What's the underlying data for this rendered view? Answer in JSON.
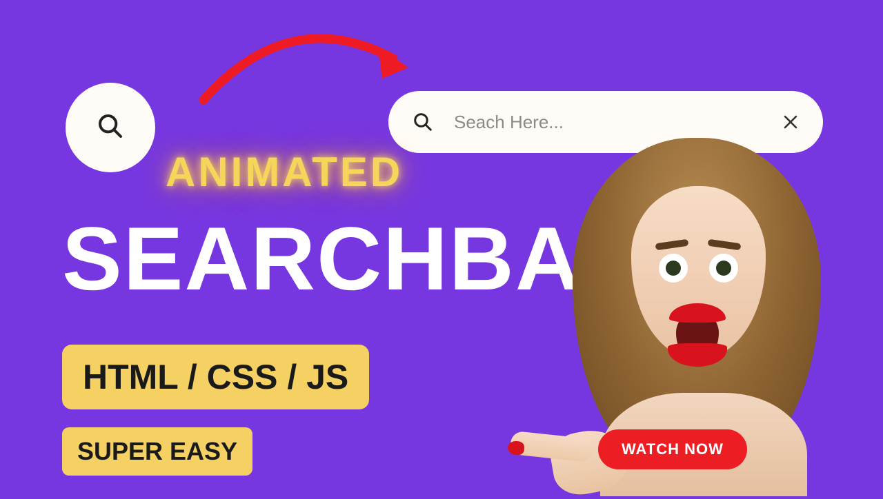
{
  "search": {
    "placeholder": "Seach Here..."
  },
  "headings": {
    "animated": "ANIMATED",
    "title": "SEARCHBAR"
  },
  "badges": {
    "tech": "HTML / CSS / JS",
    "easy": "SUPER EASY",
    "cta": "WATCH NOW"
  },
  "colors": {
    "background": "#7737e0",
    "accent_yellow": "#f5d062",
    "accent_red": "#ec1e24"
  }
}
